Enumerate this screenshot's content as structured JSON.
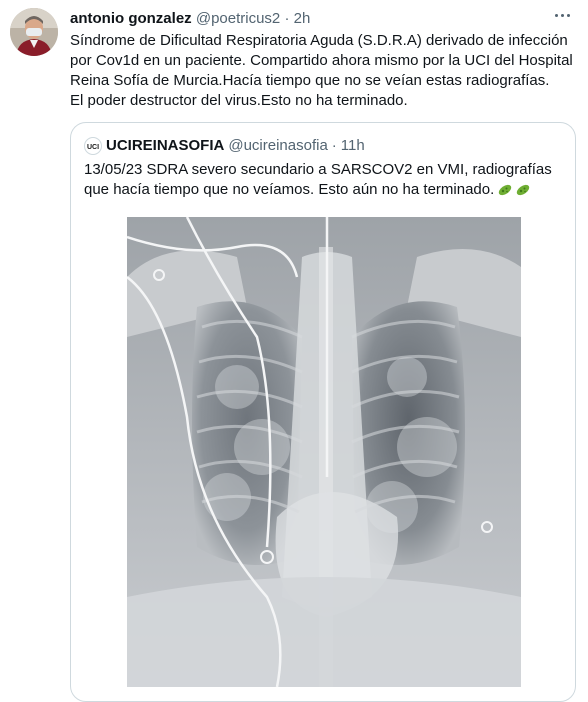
{
  "tweet": {
    "author_name": "antonio gonzalez",
    "handle": "@poetricus2",
    "separator": "·",
    "time": "2h",
    "lines": [
      "Síndrome de Dificultad Respiratoria Aguda (S.D.R.A) derivado de infección",
      "por Cov1d en un paciente. Compartido ahora mismo por la UCI del Hospital",
      "Reina Sofía de Murcia.Hacía tiempo que no se veían estas radiografías.",
      "El poder destructor del virus.Esto no ha terminado."
    ]
  },
  "quote": {
    "avatar_text": "UCI",
    "author_name": "UCIREINASOFIA",
    "handle": "@ucireinasofia",
    "separator": "·",
    "time": "11h",
    "lines": [
      "13/05/23  SDRA severo secundario a SARSCOV2 en VMI, radiografías",
      "que hacía tiempo que no veíamos.  Esto aún no ha terminado."
    ],
    "emoji": [
      "microbe-emoji",
      "microbe-emoji"
    ]
  },
  "icons": {
    "more": "more-horizontal-icon",
    "microbe_color": "#6fae33"
  }
}
